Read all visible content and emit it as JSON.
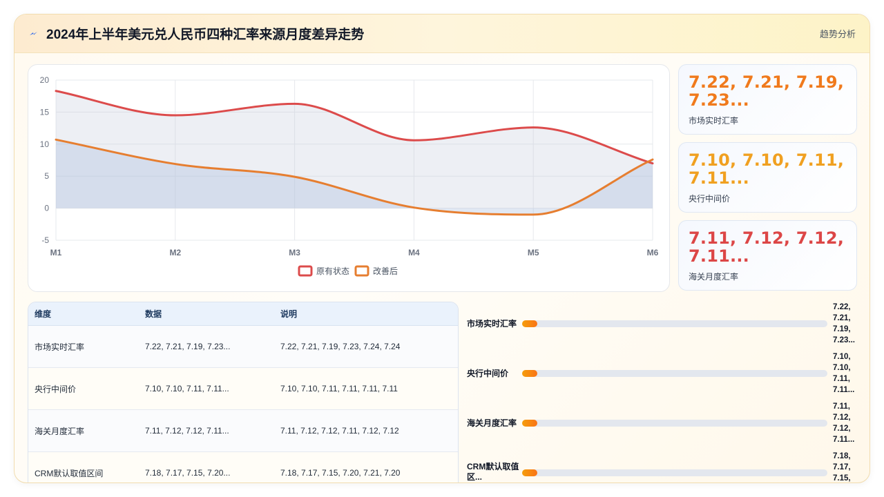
{
  "header": {
    "title": "2024年上半年美元兑人民币四种汇率来源月度差异走势",
    "right_label": "趋势分析"
  },
  "chart_data": {
    "type": "area",
    "categories": [
      "M1",
      "M2",
      "M3",
      "M4",
      "M5",
      "M6"
    ],
    "ylim": [
      -5,
      20
    ],
    "yticks": [
      -5,
      0,
      5,
      10,
      15,
      20
    ],
    "grid": true,
    "legend_position": "bottom",
    "series": [
      {
        "name": "原有状态",
        "values": [
          18.3,
          14.5,
          16.3,
          10.6,
          12.6,
          7.0
        ],
        "color": "#dc4b4b"
      },
      {
        "name": "改善后",
        "values": [
          10.7,
          6.9,
          4.9,
          0.1,
          -1.0,
          7.6
        ],
        "color": "#e67e30"
      }
    ]
  },
  "stats": [
    {
      "value": "7.22, 7.21, 7.19, 7.23...",
      "label": "市场实时汇率",
      "color": "#f07a1c"
    },
    {
      "value": "7.10, 7.10, 7.11, 7.11...",
      "label": "央行中间价",
      "color": "#f0a020"
    },
    {
      "value": "7.11, 7.12, 7.12, 7.11...",
      "label": "海关月度汇率",
      "color": "#dc4646"
    }
  ],
  "table": {
    "headers": [
      "维度",
      "数据",
      "说明"
    ],
    "rows": [
      [
        "市场实时汇率",
        "7.22, 7.21, 7.19, 7.23...",
        "7.22, 7.21, 7.19, 7.23, 7.24, 7.24"
      ],
      [
        "央行中间价",
        "7.10, 7.10, 7.11, 7.11...",
        "7.10, 7.10, 7.11, 7.11, 7.11, 7.11"
      ],
      [
        "海关月度汇率",
        "7.11, 7.12, 7.12, 7.11...",
        "7.11, 7.12, 7.12, 7.11, 7.12, 7.12"
      ],
      [
        "CRM默认取值区间",
        "7.18, 7.17, 7.15, 7.20...",
        "7.18, 7.17, 7.15, 7.20, 7.21, 7.20"
      ]
    ]
  },
  "bars": [
    {
      "label": "市场实时汇率",
      "value": "7.22,\n7.21,\n7.19,\n7.23...",
      "fill_fraction": 0.05
    },
    {
      "label": "央行中间价",
      "value": "7.10,\n7.10,\n7.11,\n7.11...",
      "fill_fraction": 0.05
    },
    {
      "label": "海关月度汇率",
      "value": "7.11,\n7.12,\n7.12,\n7.11...",
      "fill_fraction": 0.05
    },
    {
      "label": "CRM默认取值区...",
      "value": "7.18,\n7.17,\n7.15,",
      "fill_fraction": 0.05
    }
  ]
}
